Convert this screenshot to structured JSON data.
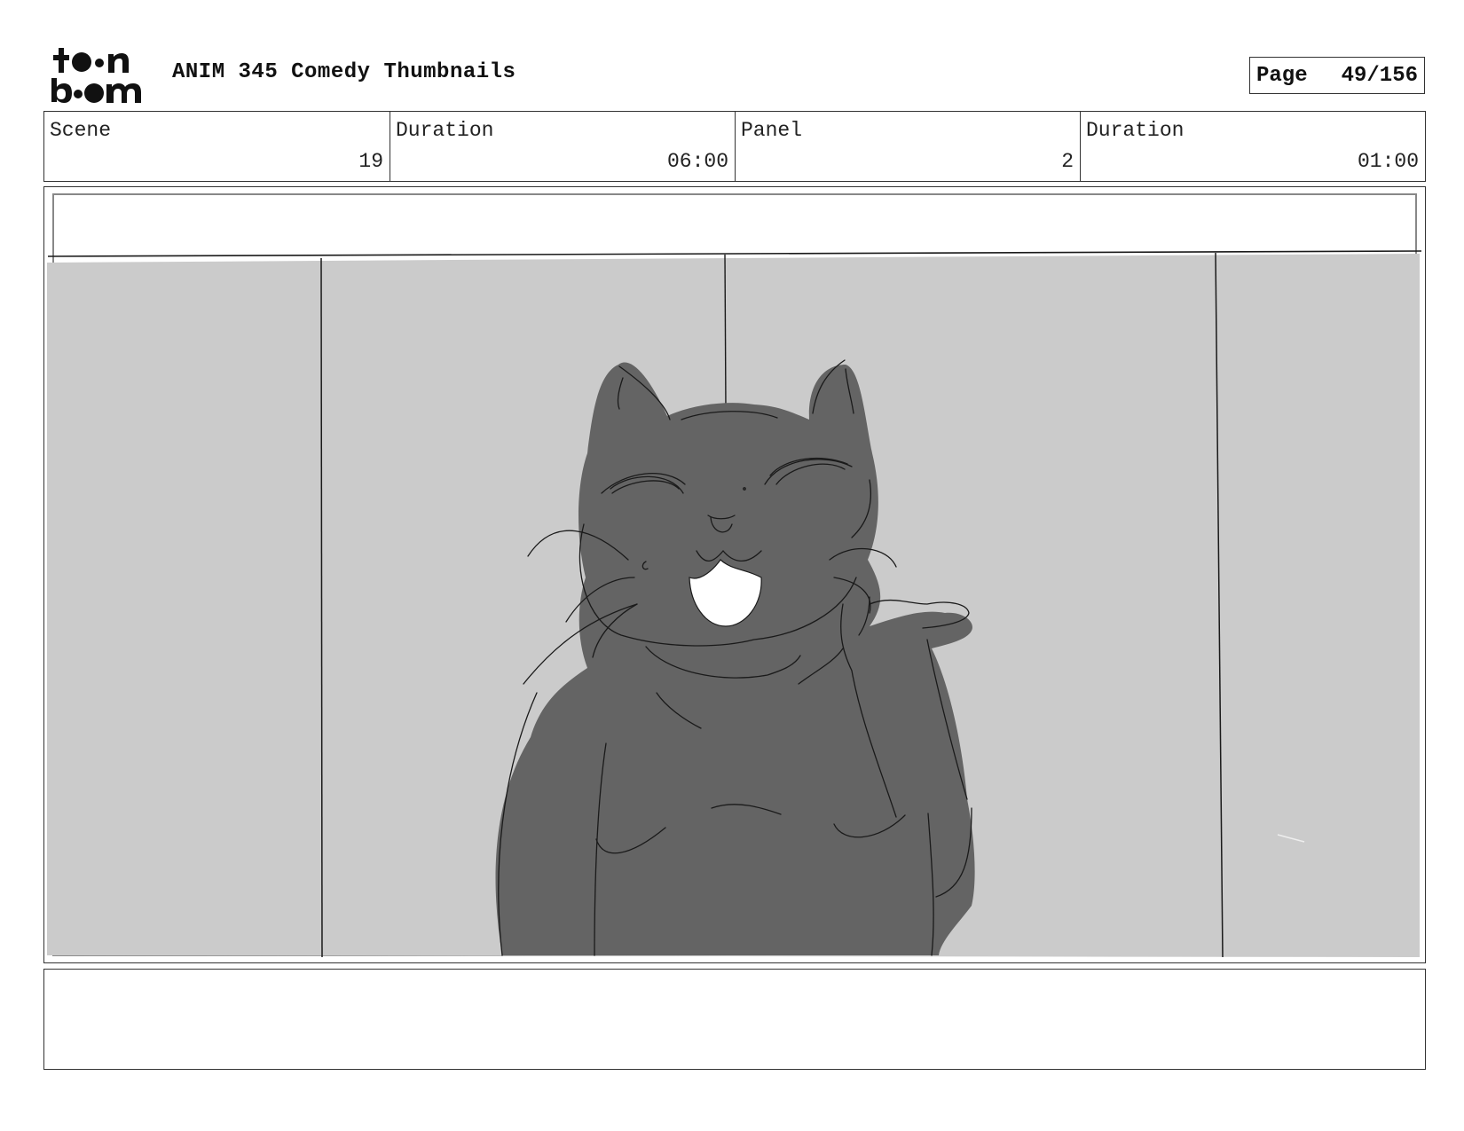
{
  "header": {
    "logo_text": "toon boom",
    "title": "ANIM 345 Comedy Thumbnails",
    "page_label": "Page",
    "page_value": "49/156"
  },
  "info": {
    "scene_label": "Scene",
    "scene_value": "19",
    "scene_duration_label": "Duration",
    "scene_duration_value": "06:00",
    "panel_label": "Panel",
    "panel_value": "2",
    "panel_duration_label": "Duration",
    "panel_duration_value": "01:00"
  },
  "colors": {
    "background_wall": "#cbcbcb",
    "cat_fill": "#646464",
    "line": "#1a1a1a"
  },
  "notes": {
    "text": ""
  }
}
